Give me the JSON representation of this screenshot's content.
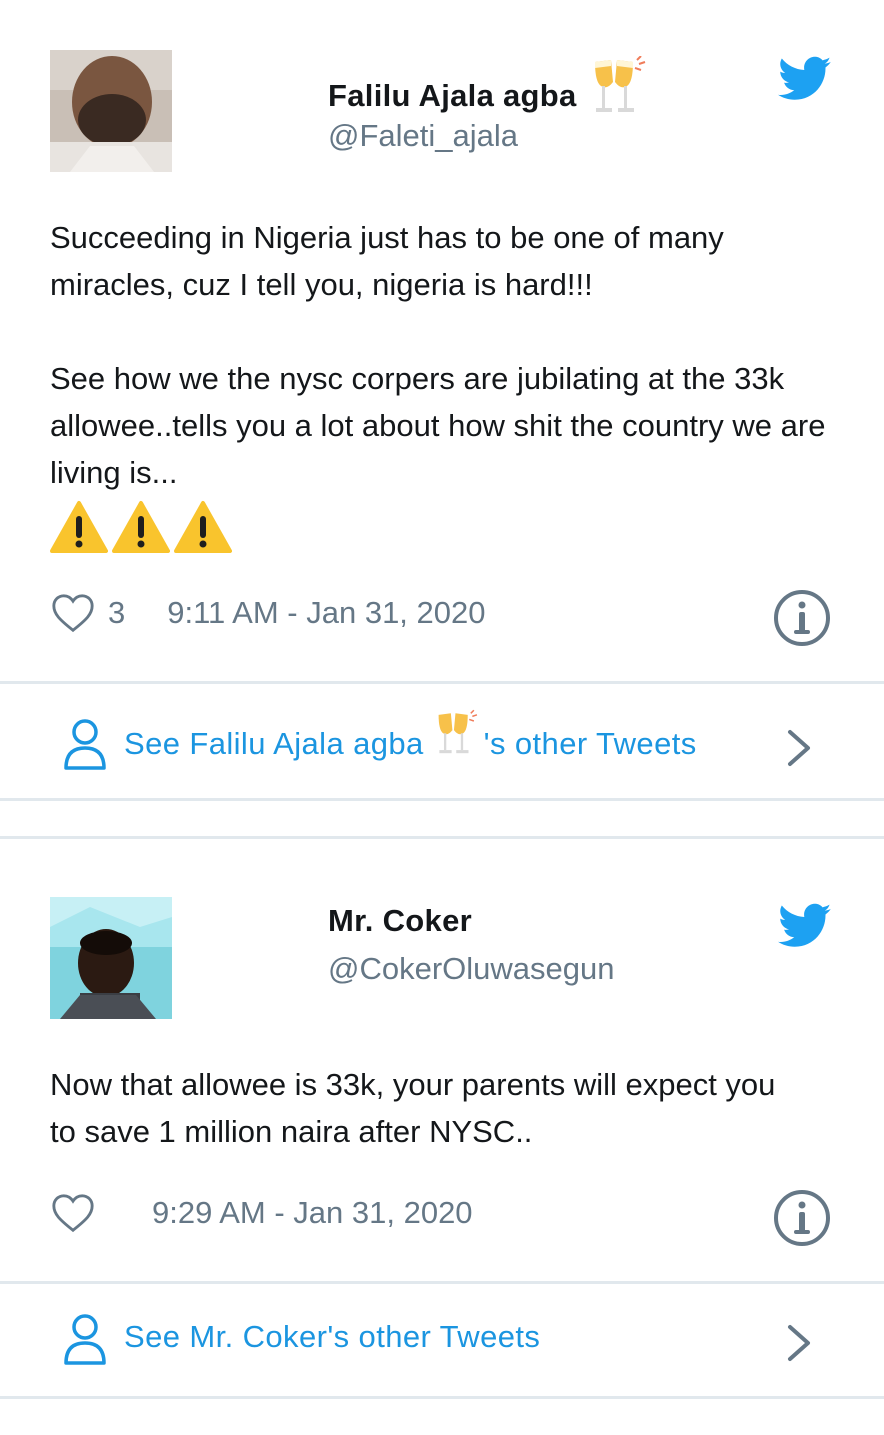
{
  "colors": {
    "accent": "#1b95e0",
    "twitter_blue": "#1da1f2",
    "text_primary": "#14171a",
    "text_secondary": "#657786",
    "divider": "#e1e8ed"
  },
  "tweets": [
    {
      "author_name": "Falilu Ajala agba",
      "author_name_emoji": "clinking-glasses-emoji",
      "handle": "@Faleti_ajala",
      "text": "Succeeding in Nigeria just has to be one of many miracles, cuz I tell you, nigeria is hard!!!\n\nSee how we the nysc corpers are jubilating at the 33k allowee..tells you a lot about how shit the country we are living is...",
      "emojis": [
        "warning-icon",
        "warning-icon",
        "warning-icon"
      ],
      "likes": "3",
      "timestamp": "9:11 AM - Jan 31, 2020",
      "see_other_prefix": "See Falilu Ajala agba",
      "see_other_suffix": "'s other Tweets"
    },
    {
      "author_name": "Mr. Coker",
      "handle": "@CokerOluwasegun",
      "text": "Now that allowee is 33k, your parents will expect you to save 1 million naira after NYSC..",
      "likes": "",
      "timestamp": "9:29 AM - Jan 31, 2020",
      "see_other_prefix": "See Mr. Coker's other Tweets",
      "see_other_suffix": ""
    }
  ]
}
